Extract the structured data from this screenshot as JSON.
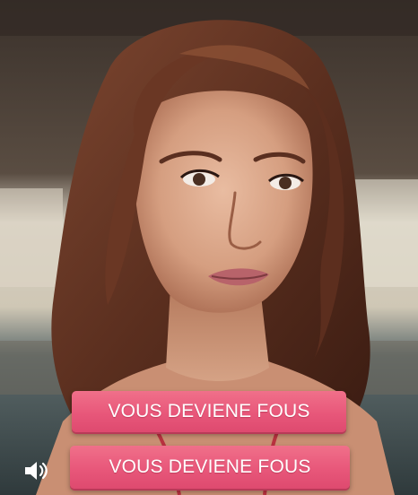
{
  "scene": {
    "character": "portrait-woman",
    "background": "blurred-room"
  },
  "choices": [
    {
      "label": "VOUS DEVIENE FOUS"
    },
    {
      "label": "VOUS DEVIENE FOUS"
    }
  ],
  "controls": {
    "sound_icon": "speaker-icon"
  },
  "colors": {
    "button": "#e8577a",
    "button_text": "#ffffff",
    "hair": "#6b3a26",
    "skin": "#d9a88c"
  }
}
